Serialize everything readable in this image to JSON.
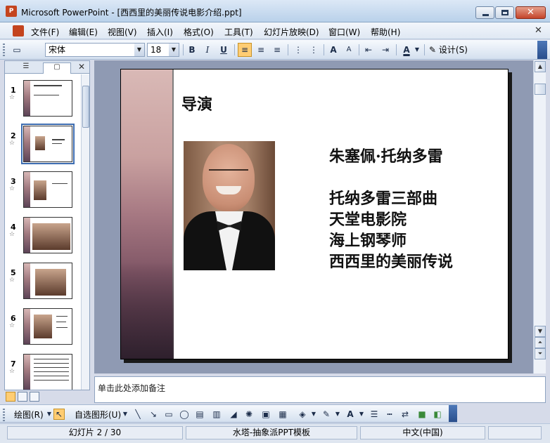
{
  "window": {
    "title": "Microsoft PowerPoint - [西西里的美丽传说电影介绍.ppt]",
    "app_icon": "powerpoint-icon",
    "close_glyph": "✕"
  },
  "menu": {
    "items": [
      "文件(F)",
      "编辑(E)",
      "视图(V)",
      "插入(I)",
      "格式(O)",
      "工具(T)",
      "幻灯片放映(D)",
      "窗口(W)",
      "帮助(H)"
    ],
    "close_glyph": "✕"
  },
  "toolbar": {
    "font_name": "宋体",
    "font_size": "18",
    "bold": "B",
    "italic": "I",
    "underline": "U",
    "design_label": "设计(S)",
    "font_color_glyph": "A",
    "grow_glyph": "A",
    "shrink_glyph": "A"
  },
  "pane": {
    "close_glyph": "✕",
    "slides": [
      {
        "number": "1"
      },
      {
        "number": "2"
      },
      {
        "number": "3"
      },
      {
        "number": "4"
      },
      {
        "number": "5"
      },
      {
        "number": "6"
      },
      {
        "number": "7"
      }
    ],
    "star_glyph": "☆"
  },
  "slide": {
    "title": "导演",
    "name": "朱塞佩·托纳多雷",
    "lines": [
      "托纳多雷三部曲",
      "天堂电影院",
      "海上钢琴师",
      "西西里的美丽传说"
    ]
  },
  "notes": {
    "placeholder": "单击此处添加备注"
  },
  "drawbar": {
    "draw_label": "绘图(R)",
    "autoshape_label": "自选图形(U)"
  },
  "status": {
    "slide_position": "幻灯片 2 / 30",
    "template": "水塔-抽象派PPT模板",
    "language": "中文(中国)"
  },
  "colors": {
    "accent": "#3d6cb0",
    "active_button": "#ffcd73",
    "editor_bg": "#8f9ab3"
  }
}
